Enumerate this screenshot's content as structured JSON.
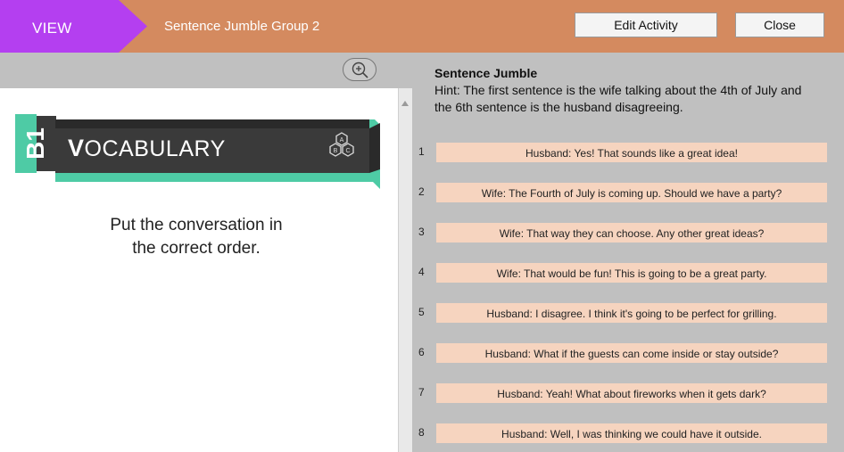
{
  "header": {
    "view_label": "VIEW",
    "title": "Sentence Jumble Group 2",
    "edit_button": "Edit Activity",
    "close_button": "Close"
  },
  "preview": {
    "level_badge": "B1",
    "banner_initial": "V",
    "banner_rest": "OCABULARY",
    "instruction_line1": "Put the conversation in",
    "instruction_line2": "the correct order."
  },
  "activity": {
    "heading": "Sentence Jumble",
    "hint": "Hint: The first sentence is the wife talking about the 4th of July and the 6th sentence is the husband disagreeing.",
    "items": [
      {
        "num": "1",
        "text": "Husband: Yes! That sounds like a great idea!"
      },
      {
        "num": "2",
        "text": "Wife: The Fourth of July is coming up. Should we have a party?"
      },
      {
        "num": "3",
        "text": "Wife: That way they can choose. Any other great ideas?"
      },
      {
        "num": "4",
        "text": "Wife: That would be fun! This is going to be a great party."
      },
      {
        "num": "5",
        "text": "Husband: I disagree. I think it's going to be perfect for grilling."
      },
      {
        "num": "6",
        "text": "Husband: What if the guests can come inside or stay outside?"
      },
      {
        "num": "7",
        "text": "Husband: Yeah! What about fireworks when it gets dark?"
      },
      {
        "num": "8",
        "text": "Husband: Well, I was thinking we could have it outside."
      }
    ]
  },
  "colors": {
    "header_bg": "#d48a5f",
    "view_tab": "#b43ff0",
    "item_bg": "#f6d4bf",
    "teal": "#4ecba5"
  },
  "icons": {
    "zoom": "zoom-in-icon",
    "abc": "abc-hexagon-icon"
  }
}
